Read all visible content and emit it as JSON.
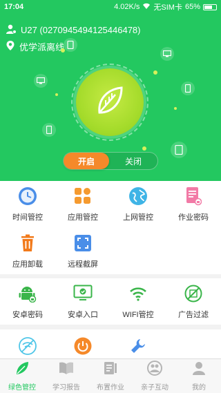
{
  "status": {
    "time": "17:04",
    "speed": "4.02K/s",
    "sim": "无SIM卡",
    "battery": "65%"
  },
  "header": {
    "user": "U27 (0270945494125446478)",
    "location": "优学派离线"
  },
  "toggle": {
    "on_label": "开启",
    "off_label": "关闭"
  },
  "colors": {
    "brand": "#23c860",
    "accent": "#f5892a"
  },
  "section1": [
    {
      "label": "时间管控",
      "icon": "clock-icon"
    },
    {
      "label": "应用管控",
      "icon": "apps-icon"
    },
    {
      "label": "上网管控",
      "icon": "globe-icon"
    },
    {
      "label": "作业密码",
      "icon": "document-lock-icon"
    },
    {
      "label": "应用卸载",
      "icon": "trash-icon"
    },
    {
      "label": "远程截屏",
      "icon": "screenshot-icon"
    }
  ],
  "section2": [
    {
      "label": "安卓密码",
      "icon": "android-lock-icon"
    },
    {
      "label": "安卓入口",
      "icon": "monitor-check-icon"
    },
    {
      "label": "WIFI管控",
      "icon": "wifi-icon"
    },
    {
      "label": "广告过滤",
      "icon": "ad-block-icon"
    }
  ],
  "tabs": [
    {
      "label": "绿色管控",
      "icon": "leaf-icon",
      "active": true
    },
    {
      "label": "学习报告",
      "icon": "book-icon",
      "active": false
    },
    {
      "label": "布置作业",
      "icon": "homework-icon",
      "active": false
    },
    {
      "label": "亲子互动",
      "icon": "family-icon",
      "active": false
    },
    {
      "label": "我的",
      "icon": "person-icon",
      "active": false
    }
  ]
}
